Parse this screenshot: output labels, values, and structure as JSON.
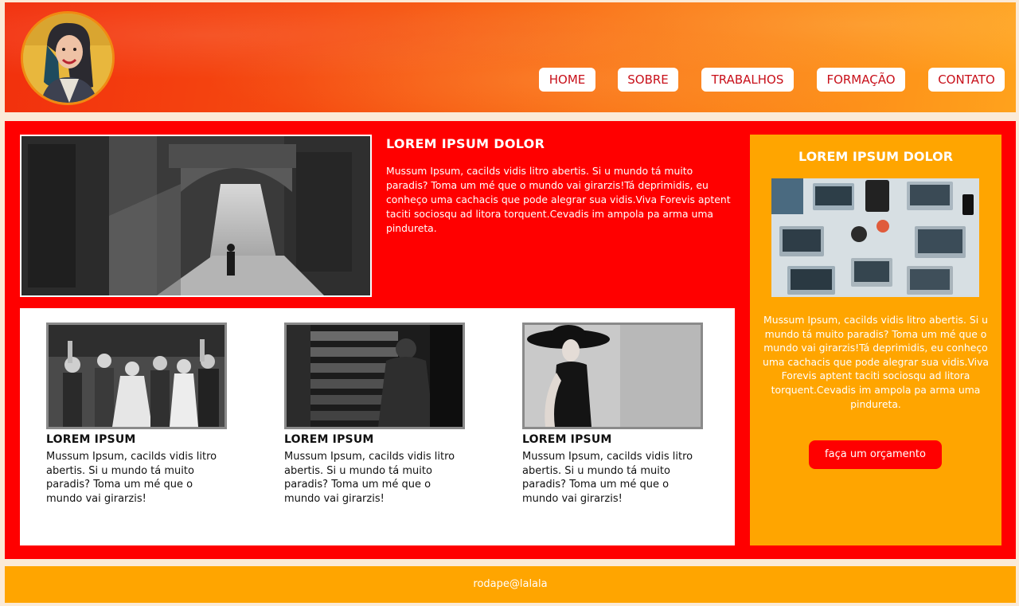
{
  "header": {
    "avatar_alt": "foto de perfil",
    "nav": [
      {
        "label": "HOME"
      },
      {
        "label": "SOBRE"
      },
      {
        "label": "TRABALHOS"
      },
      {
        "label": "FORMAÇÃO"
      },
      {
        "label": "CONTATO"
      }
    ]
  },
  "hero": {
    "title": "LOREM IPSUM DOLOR",
    "text": "Mussum Ipsum, cacilds vidis litro abertis. Si u mundo tá muito paradis? Toma um mé que o mundo vai girarzis!Tá deprimidis, eu conheço uma cachacis que pode alegrar sua vidis.Viva Forevis aptent taciti sociosqu ad litora torquent.Cevadis im ampola pa arma uma pindureta."
  },
  "cards": [
    {
      "title": "LOREM IPSUM",
      "text": "Mussum Ipsum, cacilds vidis litro abertis. Si u mundo tá muito paradis? Toma um mé que o mundo vai girarzis!"
    },
    {
      "title": "LOREM IPSUM",
      "text": "Mussum Ipsum, cacilds vidis litro abertis. Si u mundo tá muito paradis? Toma um mé que o mundo vai girarzis!"
    },
    {
      "title": "LOREM IPSUM",
      "text": "Mussum Ipsum, cacilds vidis litro abertis. Si u mundo tá muito paradis? Toma um mé que o mundo vai girarzis!"
    }
  ],
  "sidebar": {
    "title": "LOREM IPSUM DOLOR",
    "text": "Mussum Ipsum, cacilds vidis litro abertis. Si u mundo tá muito paradis? Toma um mé que o mundo vai girarzis!Tá deprimidis, eu conheço uma cachacis que pode alegrar sua vidis.Viva Forevis aptent taciti sociosqu ad litora torquent.Cevadis im ampola pa arma uma pindureta.",
    "button_label": "faça um orçamento"
  },
  "footer": {
    "text": "rodape@lalala"
  },
  "colors": {
    "main_red": "#ff0000",
    "accent_orange": "#ffa500",
    "nav_text": "#c8101a"
  }
}
